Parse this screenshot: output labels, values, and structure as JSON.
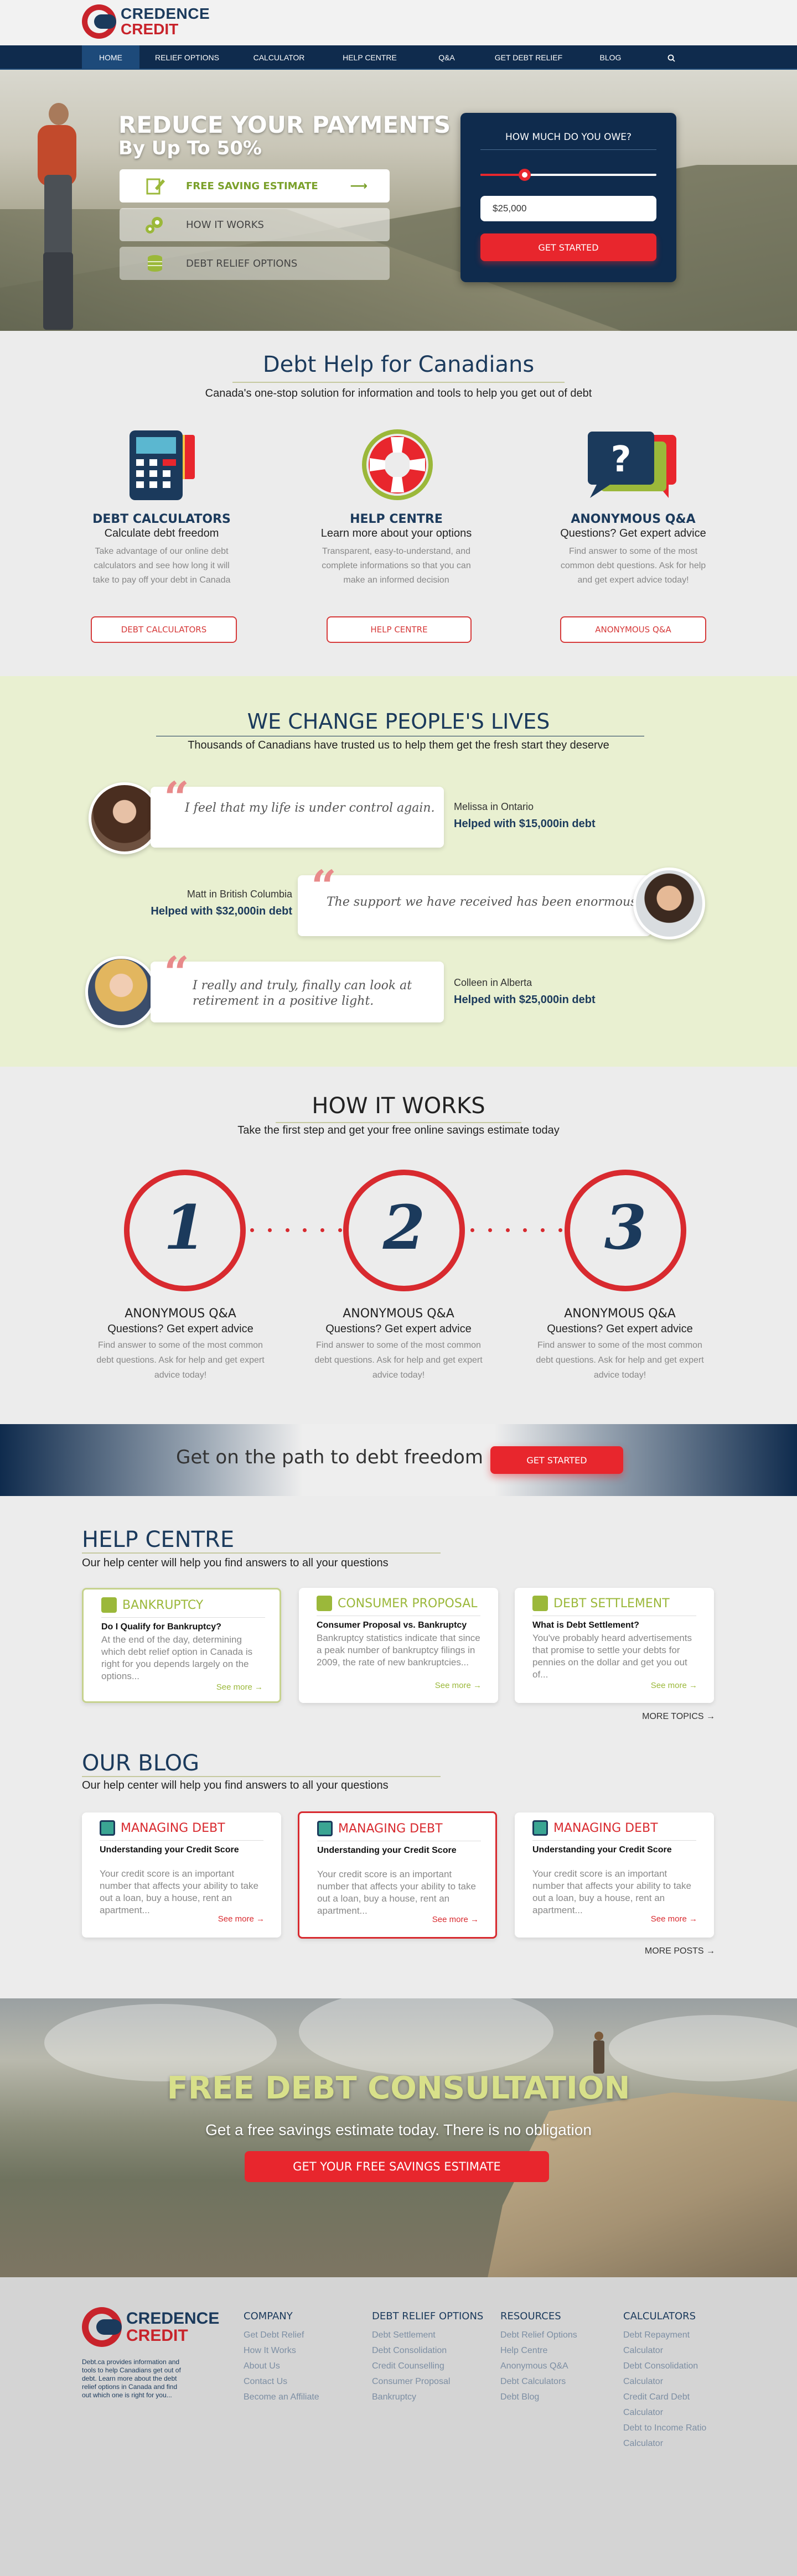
{
  "brand": {
    "name_line1": "CREDENCE",
    "name_line2": "CREDIT"
  },
  "nav": {
    "items": [
      "HOME",
      "RELIEF OPTIONS",
      "CALCULATOR",
      "HELP CENTRE",
      "Q&A",
      "GET DEBT RELIEF",
      "BLOG"
    ],
    "active": "HOME",
    "search_icon": "search-icon"
  },
  "hero": {
    "title": "REDUCE YOUR PAYMENTS",
    "subtitle": "By Up To 50%",
    "buttons": [
      {
        "label": "FREE SAVING ESTIMATE",
        "icon": "pencil-icon"
      },
      {
        "label": "HOW IT WORKS",
        "icon": "gears-icon"
      },
      {
        "label": "DEBT RELIEF OPTIONS",
        "icon": "coins-icon"
      }
    ],
    "arrow": "⟶",
    "owe": {
      "question": "HOW MUCH DO YOU OWE?",
      "amount": "$25,000",
      "slider_fraction": 0.25,
      "button": "GET STARTED"
    }
  },
  "debt_help": {
    "title": "Debt Help for Canadians",
    "subtitle": "Canada's one-stop solution for information and tools to help you get out of debt",
    "columns": [
      {
        "title": "DEBT CALCULATORS",
        "sub": "Calculate debt freedom",
        "desc": "Take advantage of our online debt calculators and see how long it will take to pay off your debt in Canada",
        "button": "DEBT CALCULATORS",
        "icon": "calculator-icon"
      },
      {
        "title": "HELP CENTRE",
        "sub": "Learn more about your options",
        "desc": "Transparent, easy-to-understand, and complete informations so that you can make an informed decision",
        "button": "HELP CENTRE",
        "icon": "lifebuoy-icon"
      },
      {
        "title": "ANONYMOUS Q&A",
        "sub": "Questions? Get expert advice",
        "desc": "Find answer to some of the most common debt questions. Ask for help and get expert advice today!",
        "button": "ANONYMOUS Q&A",
        "icon": "question-bubble-icon"
      }
    ]
  },
  "lives": {
    "title": "WE CHANGE PEOPLE'S LIVES",
    "subtitle": "Thousands of Canadians have trusted us to help them get the fresh start they deserve",
    "testimonials": [
      {
        "quote": "I feel that my life is under control again.",
        "name": "Melissa in Ontario",
        "amount": "Helped with $15,000in debt"
      },
      {
        "quote": "The support we have received has been enormous.",
        "name": "Matt in British Columbia",
        "amount": "Helped with $32,000in debt"
      },
      {
        "quote": "I really and truly, finally can look at retirement in a positive light.",
        "name": "Colleen in Alberta",
        "amount": "Helped with $25,000in debt"
      }
    ],
    "quote_mark": "“"
  },
  "how": {
    "title": "HOW IT WORKS",
    "subtitle": "Take the first step and get your free online savings estimate today",
    "steps": [
      {
        "num": "1",
        "title": "ANONYMOUS Q&A",
        "sub": "Questions? Get expert advice",
        "desc": "Find answer to some of the most common debt questions. Ask for help and get expert advice today!"
      },
      {
        "num": "2",
        "title": "ANONYMOUS Q&A",
        "sub": "Questions? Get expert advice",
        "desc": "Find answer to some of the most common debt questions. Ask for help and get expert advice today!"
      },
      {
        "num": "3",
        "title": "ANONYMOUS Q&A",
        "sub": "Questions? Get expert advice",
        "desc": "Find answer to some of the most common debt questions. Ask for help and get expert advice today!"
      }
    ]
  },
  "path": {
    "text": "Get on the path to debt freedom",
    "button": "GET STARTED"
  },
  "help_centre": {
    "title": "HELP CENTRE",
    "subtitle": "Our help center will help you find answers to all your questions",
    "cards": [
      {
        "category": "BANKRUPTCY",
        "question": "Do I Qualify for Bankruptcy?",
        "excerpt": "At the end of the day, determining which debt relief option in Canada is right for you depends largely on the options...",
        "more": "See more →"
      },
      {
        "category": "CONSUMER PROPOSAL",
        "question": "Consumer Proposal vs. Bankruptcy",
        "excerpt": "Bankruptcy statistics indicate that since a peak number of bankruptcy filings in 2009, the rate of new bankruptcies...",
        "more": "See more →"
      },
      {
        "category": "DEBT SETTLEMENT",
        "question": "What is Debt Settlement?",
        "excerpt": "You've probably heard advertisements that promise to settle your debts for pennies on the dollar and get you out of...",
        "more": "See more →"
      }
    ],
    "more_link": "MORE TOPICS →"
  },
  "blog": {
    "title": "OUR BLOG",
    "subtitle": "Our help center will help you find answers to all your questions",
    "cards": [
      {
        "category": "MANAGING DEBT",
        "question": "Understanding your Credit Score",
        "excerpt": "Your credit score is an important number that affects your ability to take out a loan, buy a house, rent an apartment...",
        "more": "See more →"
      },
      {
        "category": "MANAGING DEBT",
        "question": "Understanding your Credit Score",
        "excerpt": "Your credit score is an important number that affects your ability to take out a loan, buy a house, rent an apartment...",
        "more": "See more →"
      },
      {
        "category": "MANAGING DEBT",
        "question": "Understanding your Credit Score",
        "excerpt": "Your credit score is an important number that affects your ability to take out a loan, buy a house, rent an apartment...",
        "more": "See more →"
      }
    ],
    "more_link": "MORE POSTS →"
  },
  "consult": {
    "title": "FREE DEBT CONSULTATION",
    "subtitle": "Get a free savings estimate today. There is no obligation",
    "button": "GET  YOUR FREE SAVINGS ESTIMATE"
  },
  "footer": {
    "about": "Debt.ca provides information and tools to help Canadians get out of debt. Learn more about the debt relief options in Canada and find out which one is right for you...",
    "columns": [
      {
        "heading": "COMPANY",
        "links": [
          "Get Debt Relief",
          "How It Works",
          "About Us",
          "Contact Us",
          "Become an Affiliate"
        ]
      },
      {
        "heading": "DEBT RELIEF OPTIONS",
        "links": [
          "Debt Settlement",
          "Debt Consolidation",
          "Credit Counselling",
          "Consumer Proposal",
          "Bankruptcy"
        ]
      },
      {
        "heading": "RESOURCES",
        "links": [
          "Debt Relief Options",
          "Help Centre",
          "Anonymous Q&A",
          "Debt Calculators",
          "Debt Blog"
        ]
      },
      {
        "heading": "CALCULATORS",
        "links": [
          "Debt Repayment Calculator",
          "Debt Consolidation Calculator",
          "Credit Card Debt Calculator",
          "Debt to Income Ratio Calculator"
        ]
      }
    ]
  },
  "colors": {
    "navy": "#0f2b4d",
    "red": "#e8262d",
    "green": "#9bb83a",
    "mint_bg": "#e9f0d1"
  }
}
